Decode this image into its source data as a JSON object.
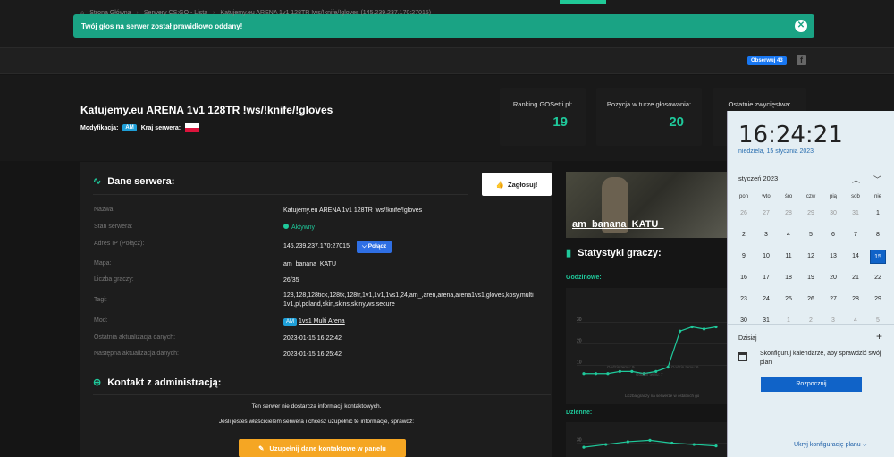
{
  "alert": {
    "message": "Twój głos na serwer został prawidłowo oddany!",
    "close": "✕"
  },
  "breadcrumb": [
    "Strona Główna",
    "Serwery CS:GO - Lista",
    "Katujemy.eu ARENA 1v1 128TR !ws/!knife/!gloves (145.239.237.170:27015)"
  ],
  "social": {
    "follow_label": "Obserwuj 43",
    "fb_icon": "facebook-icon"
  },
  "server": {
    "title": "Katujemy.eu ARENA 1v1 128TR !ws/!knife/!gloves",
    "mod_label": "Modyfikacja:",
    "mod_badge": "AM",
    "country_label": "Kraj serwera:"
  },
  "stats": [
    {
      "label": "Ranking GOSetti.pl:",
      "value": "19"
    },
    {
      "label": "Pozycja w turze głosowania:",
      "value": "20"
    },
    {
      "label": "Ostatnie zwycięstwa:",
      "value": ""
    }
  ],
  "details": {
    "title": "Dane serwera:",
    "vote_button": "Zagłosuj!",
    "rows": [
      {
        "key": "Nazwa:",
        "value": "Katujemy.eu ARENA 1v1 128TR !ws/!knife/!gloves"
      },
      {
        "key": "Stan serwera:",
        "value": "Aktywny"
      },
      {
        "key": "Adres IP (Połącz):",
        "value": "145.239.237.170:27015"
      },
      {
        "key": "Mapa:",
        "value": "am_banana_KATU_"
      },
      {
        "key": "Liczba graczy:",
        "value": "26/35"
      },
      {
        "key": "Tagi:",
        "value": "128,128,128tick,128tk,128tr,1v1,1v1,1vs1,24,am_,aren,arena,arena1vs1,gloves,kosy,multi 1v1,pl,poland,skin,skins,skiny,ws,secure"
      },
      {
        "key": "Mod:",
        "value": "1vs1 Multi Arena"
      },
      {
        "key": "Ostatnia aktualizacja danych:",
        "value": "2023-01-15 16:22:42"
      },
      {
        "key": "Następna aktualizacja danych:",
        "value": "2023-01-15 16:25:42"
      }
    ],
    "connect_button": "Połącz",
    "mod_badge": "AM"
  },
  "contact": {
    "title": "Kontakt z administracją:",
    "line1": "Ten serwer nie dostarcza informacji kontaktowych.",
    "line2": "Jeśli jesteś właścicielem serwera i chcesz uzupełnić te informacje, sprawdź:",
    "button": "Uzupełnij dane kontaktowe w panelu"
  },
  "map_card": {
    "name": "am_banana_KATU_"
  },
  "player_stats": {
    "title": "Statystyki graczy:",
    "hourly_label": "Godzinowe:",
    "daily_label": "Dzienne:",
    "hourly_caption": "Liczba graczy na serwerze w ostatnich go",
    "tick_a": "Godzin temu: 9",
    "tick_b": "Godzin temu: 7",
    "tick_c": "Godzin temu: 6"
  },
  "chart_data": [
    {
      "type": "line",
      "title": "Godzinowe:",
      "xlabel": "Liczba graczy na serwerze w ostatnich go",
      "yticks": [
        10,
        20,
        30
      ],
      "ylim": [
        0,
        40
      ],
      "values": [
        6,
        6,
        6,
        7,
        7,
        6,
        7,
        9,
        26,
        28,
        27,
        28
      ]
    },
    {
      "type": "line",
      "title": "Dzienne:",
      "yticks": [
        30
      ],
      "ylim": [
        20,
        40
      ],
      "values": [
        27,
        29,
        31,
        32,
        30,
        29,
        28
      ]
    }
  ],
  "calendar": {
    "time": "16:24:21",
    "date": "niedziela, 15 stycznia 2023",
    "month": "styczeń 2023",
    "weekdays": [
      "pon",
      "wto",
      "śro",
      "czw",
      "pią",
      "sob",
      "nie"
    ],
    "days": [
      [
        "26",
        "27",
        "28",
        "29",
        "30",
        "31",
        "1"
      ],
      [
        "2",
        "3",
        "4",
        "5",
        "6",
        "7",
        "8"
      ],
      [
        "9",
        "10",
        "11",
        "12",
        "13",
        "14",
        "15"
      ],
      [
        "16",
        "17",
        "18",
        "19",
        "20",
        "21",
        "22"
      ],
      [
        "23",
        "24",
        "25",
        "26",
        "27",
        "28",
        "29"
      ],
      [
        "30",
        "31",
        "1",
        "2",
        "3",
        "4",
        "5"
      ]
    ],
    "agenda_title": "Dzisiaj",
    "agenda_text": "Skonfiguruj kalendarze, aby sprawdzić swój plan",
    "start_button": "Rozpocznij",
    "hide_link": "Ukryj konfigurację planu ⌵"
  }
}
